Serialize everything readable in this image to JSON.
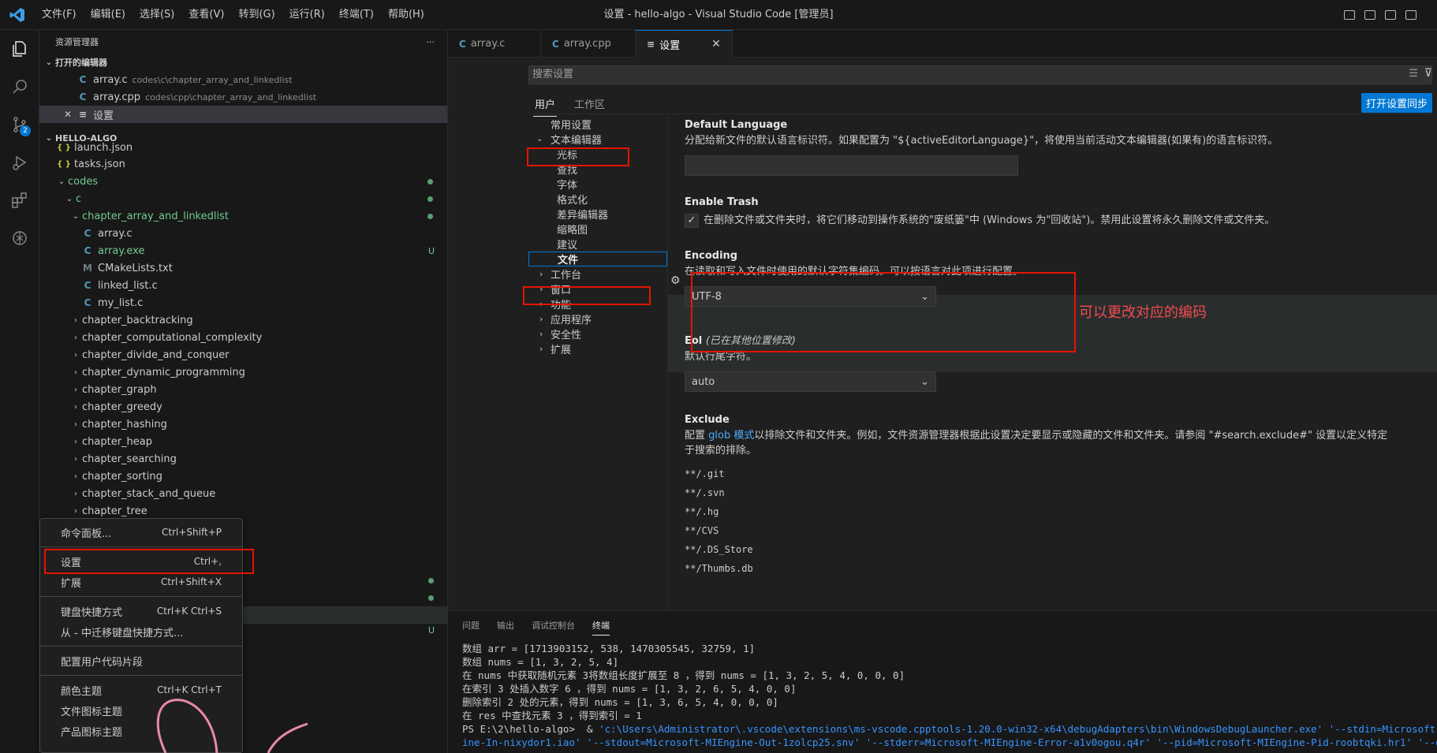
{
  "titlebar": {
    "menus": [
      "文件(F)",
      "编辑(E)",
      "选择(S)",
      "查看(V)",
      "转到(G)",
      "运行(R)",
      "终端(T)",
      "帮助(H)"
    ],
    "title": "设置 - hello-algo - Visual Studio Code [管理员]"
  },
  "activity_bar": {
    "scm_badge": "2"
  },
  "sidebar": {
    "title": "资源管理器",
    "more": "···",
    "open_editors_label": "打开的编辑器",
    "open_editors": [
      {
        "icon": "C",
        "name": "array.c",
        "path": "codes\\c\\chapter_array_and_linkedlist"
      },
      {
        "icon": "C",
        "name": "array.cpp",
        "path": "codes\\cpp\\chapter_array_and_linkedlist"
      },
      {
        "icon": "≡",
        "name": "设置",
        "path": "",
        "close": "✕"
      }
    ],
    "workspace_label": "HELLO-ALGO",
    "tree": [
      {
        "icon": "{ }",
        "name": "launch.json"
      },
      {
        "icon": "{ }",
        "name": "tasks.json"
      },
      {
        "name": "codes"
      },
      {
        "name": "c"
      },
      {
        "name": "chapter_array_and_linkedlist"
      },
      {
        "icon": "C",
        "name": "array.c"
      },
      {
        "icon": "C",
        "name": "array.exe",
        "mark": "U"
      },
      {
        "icon": "M",
        "name": "CMakeLists.txt"
      },
      {
        "icon": "C",
        "name": "linked_list.c"
      },
      {
        "icon": "C",
        "name": "my_list.c"
      },
      {
        "name": "chapter_backtracking"
      },
      {
        "name": "chapter_computational_complexity"
      },
      {
        "name": "chapter_divide_and_conquer"
      },
      {
        "name": "chapter_dynamic_programming"
      },
      {
        "name": "chapter_graph"
      },
      {
        "name": "chapter_greedy"
      },
      {
        "name": "chapter_hashing"
      },
      {
        "name": "chapter_heap"
      },
      {
        "name": "chapter_searching"
      },
      {
        "name": "chapter_sorting"
      },
      {
        "name": "chapter_stack_and_queue"
      },
      {
        "name": "chapter_tree"
      }
    ],
    "trailing_mark": "U"
  },
  "context_menu": {
    "items": [
      {
        "label": "命令面板...",
        "key": "Ctrl+Shift+P"
      },
      {
        "label": "设置",
        "key": "Ctrl+,"
      },
      {
        "label": "扩展",
        "key": "Ctrl+Shift+X"
      },
      {
        "label": "键盘快捷方式",
        "key": "Ctrl+K Ctrl+S"
      },
      {
        "label": "从 - 中迁移键盘快捷方式...",
        "key": ""
      },
      {
        "label": "配置用户代码片段",
        "key": ""
      },
      {
        "label": "颜色主题",
        "key": "Ctrl+K Ctrl+T"
      },
      {
        "label": "文件图标主题",
        "key": ""
      },
      {
        "label": "产品图标主题",
        "key": ""
      }
    ]
  },
  "tabs": [
    {
      "icon": "C",
      "label": "array.c"
    },
    {
      "icon": "C",
      "label": "array.cpp"
    },
    {
      "icon": "≡",
      "label": "设置",
      "close": "✕"
    }
  ],
  "settings": {
    "search_placeholder": "搜索设置",
    "scope_tabs": [
      "用户",
      "工作区"
    ],
    "sync_button": "打开设置同步",
    "toc": [
      {
        "label": "常用设置",
        "level": 0
      },
      {
        "label": "文本编辑器",
        "level": 0,
        "expanded": true
      },
      {
        "label": "光标",
        "level": 1
      },
      {
        "label": "查找",
        "level": 1
      },
      {
        "label": "字体",
        "level": 1
      },
      {
        "label": "格式化",
        "level": 1
      },
      {
        "label": "差异编辑器",
        "level": 1
      },
      {
        "label": "缩略图",
        "level": 1
      },
      {
        "label": "建议",
        "level": 1
      },
      {
        "label": "文件",
        "level": 1,
        "selected": true
      },
      {
        "label": "工作台",
        "level": 0
      },
      {
        "label": "窗口",
        "level": 0
      },
      {
        "label": "功能",
        "level": 0
      },
      {
        "label": "应用程序",
        "level": 0
      },
      {
        "label": "安全性",
        "level": 0
      },
      {
        "label": "扩展",
        "level": 0
      }
    ],
    "default_language": {
      "title": "Default Language",
      "desc": "分配给新文件的默认语言标识符。如果配置为 \"${activeEditorLanguage}\"，将使用当前活动文本编辑器(如果有)的语言标识符。",
      "value": ""
    },
    "enable_trash": {
      "title": "Enable Trash",
      "desc": "在删除文件或文件夹时，将它们移动到操作系统的\"废纸篓\"中 (Windows 为\"回收站\")。禁用此设置将永久删除文件或文件夹。",
      "checked": true
    },
    "encoding": {
      "title": "Encoding",
      "desc": "在读取和写入文件时使用的默认字符集编码。可以按语言对此项进行配置。",
      "value": "UTF-8"
    },
    "eol": {
      "title": "Eol",
      "modified": "(已在其他位置修改)",
      "desc": "默认行尾字符。",
      "value": "auto"
    },
    "exclude": {
      "title": "Exclude",
      "desc_pre": "配置 ",
      "desc_link": "glob 模式",
      "desc_post": "以排除文件和文件夹。例如，文件资源管理器根据此设置决定要显示或隐藏的文件和文件夹。请参阅 \"#search.exclude#\" 设置以定义特定于搜索的排除。",
      "patterns": [
        "**/.git",
        "**/.svn",
        "**/.hg",
        "**/CVS",
        "**/.DS_Store",
        "**/Thumbs.db"
      ]
    }
  },
  "annotation": "可以更改对应的编码",
  "panel": {
    "tabs": [
      "问题",
      "输出",
      "调试控制台",
      "终端"
    ],
    "terminal_lines": [
      "数组 arr = [1713903152, 538, 1470305545, 32759, 1]",
      "数组 nums = [1, 3, 2, 5, 4]",
      "在 nums 中获取随机元素 3将数组长度扩展至 8 ，得到 nums = [1, 3, 2, 5, 4, 0, 0, 0]",
      "在索引 3 处插入数字 6 ，得到 nums = [1, 3, 2, 6, 5, 4, 0, 0]",
      "删除索引 2 处的元素，得到 nums = [1, 3, 6, 5, 4, 0, 0, 0]",
      "在 res 中查找元素 3 ，得到索引 = 1"
    ],
    "ps_prompt": "PS E:\\2\\hello-algo>  & ",
    "ps_cmd": "'c:\\Users\\Administrator\\.vscode\\extensions\\ms-vscode.cpptools-1.20.0-win32-x64\\debugAdapters\\bin\\WindowsDebugLauncher.exe' '--stdin=Microsoft-MIEng",
    "ps_cmd2": "ine-In-nixydor1.iao' '--stdout=Microsoft-MIEngine-Out-1zolcp25.snv' '--stderr=Microsoft-MIEngine-Error-a1v0ogou.q4r' '--pid=Microsoft-MIEngine-Pid-roobtqki.hr1' '--dbgExe"
  },
  "colors": {
    "accent": "#0078d4",
    "annotation_red": "#e51400",
    "git_untracked": "#73c991"
  }
}
